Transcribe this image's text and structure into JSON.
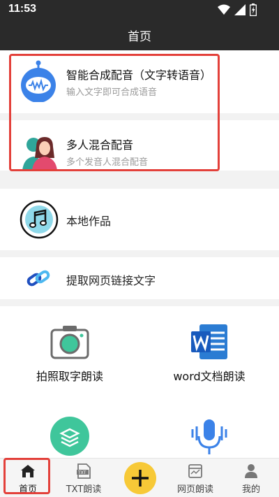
{
  "status": {
    "time": "11:53"
  },
  "header": {
    "title": "首页"
  },
  "features": [
    {
      "title": "智能合成配音（文字转语音）",
      "subtitle": "输入文字即可合成语音"
    },
    {
      "title": "多人混合配音",
      "subtitle": "多个发音人混合配音"
    }
  ],
  "local_works": {
    "label": "本地作品"
  },
  "extract_link": {
    "label": "提取网页链接文字"
  },
  "grid": [
    {
      "label": "拍照取字朗读"
    },
    {
      "label": "word文档朗读"
    }
  ],
  "tabbar": {
    "home": "首页",
    "txt": "TXT朗读",
    "web": "网页朗读",
    "mine": "我的"
  },
  "colors": {
    "accent": "#e3403a",
    "plus": "#f7c937",
    "robot": "#3b82e8"
  }
}
